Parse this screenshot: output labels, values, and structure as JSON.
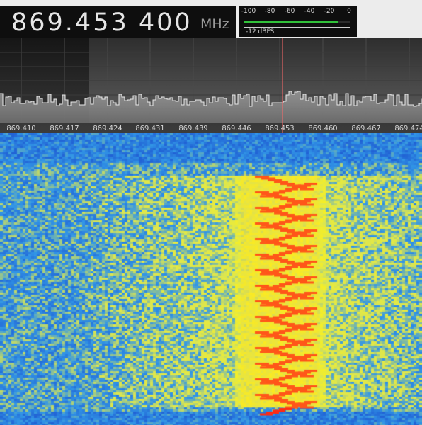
{
  "frequency": {
    "value": "869.453 400",
    "unit": "MHz"
  },
  "level_meter": {
    "scale_labels": [
      "-100",
      "-80",
      "-60",
      "-40",
      "-20",
      "0"
    ],
    "reading_text": "-12 dBFS",
    "reading_dbfs": -12
  },
  "spectrum": {
    "axis_labels": [
      "869.410",
      "869.417",
      "869.424",
      "869.431",
      "869.439",
      "869.446",
      "869.453",
      "869.460",
      "869.467",
      "869.474"
    ],
    "tuned_frequency_label": "869.453"
  },
  "colors": {
    "meter_bar": "#31c13a",
    "cursor_line": "#ff6a6a",
    "waterfall_low": "#1a4fd8",
    "waterfall_mid": "#f2ee22",
    "waterfall_high": "#ff2a14"
  }
}
